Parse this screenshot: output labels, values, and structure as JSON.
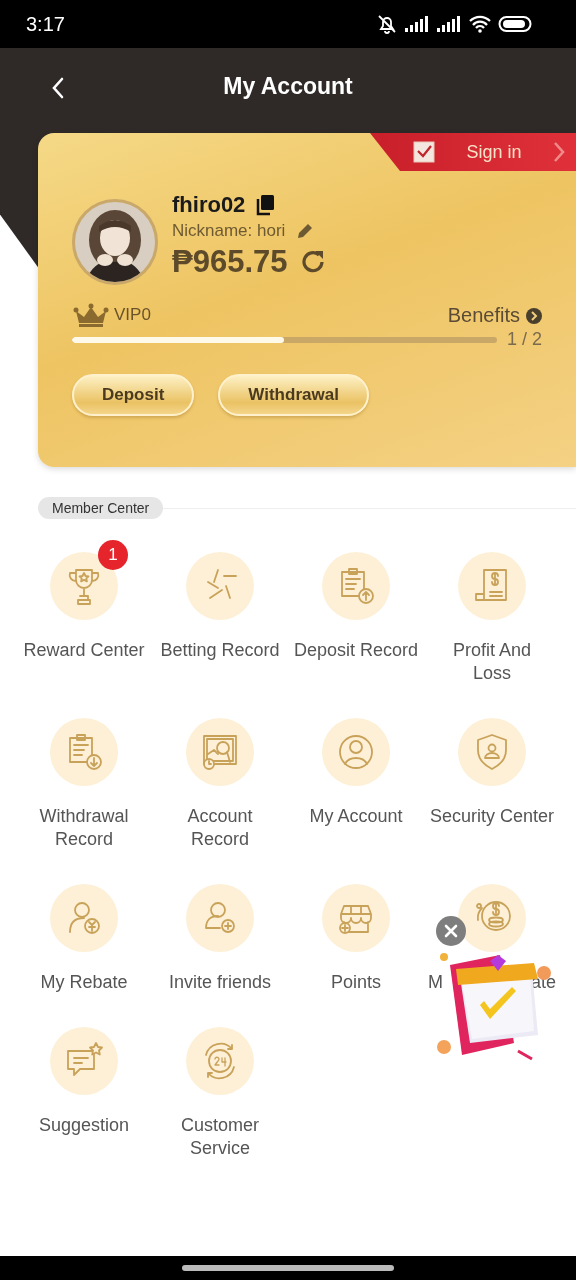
{
  "status_bar": {
    "time": "3:17"
  },
  "header": {
    "title": "My Account"
  },
  "profile": {
    "username": "fhiro02",
    "nickname": "Nickname: hori",
    "balance": "₱965.75",
    "vip": "VIP0",
    "benefits": "Benefits",
    "progress": {
      "level": 0.5,
      "reading": "1 / 2"
    },
    "sign_in": "Sign in",
    "buttons": [
      "Deposit",
      "Withdrawal"
    ]
  },
  "member_center": {
    "title": "Member Center",
    "items": [
      {
        "label": "Reward Center",
        "badge": "1"
      },
      {
        "label": "Betting Record"
      },
      {
        "label": "Deposit Record"
      },
      {
        "label": "Profit And\nLoss"
      },
      {
        "label": "Withdrawal\nRecord"
      },
      {
        "label": "Account\nRecord"
      },
      {
        "label": "My Account"
      },
      {
        "label": "Security Center"
      },
      {
        "label": "My Rebate"
      },
      {
        "label": "Invite friends"
      },
      {
        "label": "Points"
      },
      {
        "label_parts": [
          "M",
          "ate"
        ]
      },
      {
        "label": "Suggestion"
      },
      {
        "label": "Customer\nService"
      }
    ]
  }
}
